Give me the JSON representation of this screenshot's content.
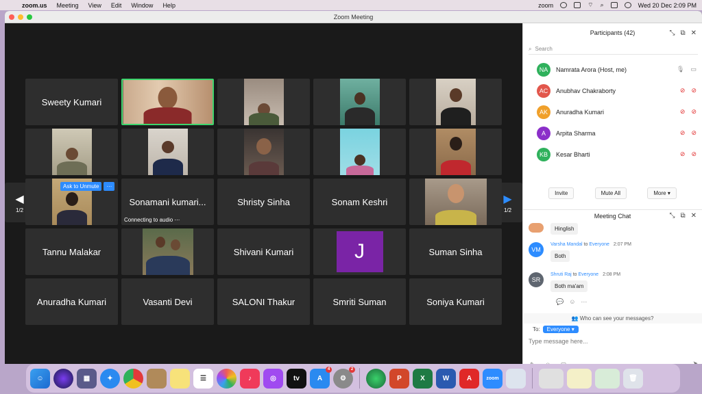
{
  "menubar": {
    "app": "zoom.us",
    "items": [
      "Meeting",
      "View",
      "Edit",
      "Window",
      "Help"
    ],
    "status_brand": "zoom",
    "clock": "Wed 20 Dec  2:09 PM"
  },
  "window": {
    "title": "Zoom Meeting"
  },
  "tiles": {
    "t0": "Sweety Kumari",
    "t12": "Sonamani kumari...",
    "t13": "Shristy Sinha",
    "t14": "Sonam Keshri",
    "t16": "Tannu Malakar",
    "t18": "Shivani Kumari",
    "t19_avatar": "J",
    "t20": "Suman Sinha",
    "t21": "Anuradha Kumari",
    "t22": "Vasanti Devi",
    "t23": "SALONI Thakur",
    "t24": "Smriti Suman",
    "t25": "Soniya Kumari",
    "connecting": "Connecting to audio",
    "ask_unmute": "Ask to Unmute",
    "more": "···"
  },
  "pager": {
    "left": "1/2",
    "right": "1/2"
  },
  "participants": {
    "title": "Participants (42)",
    "search_placeholder": "Search",
    "list": [
      {
        "initials": "NA",
        "name": "Namrata Arora (Host, me)",
        "color": "#2fb15c"
      },
      {
        "initials": "AC",
        "name": "Anubhav Chakraborty",
        "color": "#e2574c"
      },
      {
        "initials": "AK",
        "name": "Anuradha Kumari",
        "color": "#f0a02b"
      },
      {
        "initials": "A",
        "name": "Arpita Sharma",
        "color": "#8b2fc9"
      },
      {
        "initials": "KB",
        "name": "Kesar Bharti",
        "color": "#2fb15c"
      }
    ],
    "buttons": {
      "invite": "Invite",
      "mute_all": "Mute All",
      "more": "More ▾"
    }
  },
  "chat": {
    "title": "Meeting Chat",
    "prev_message": "Hinglish",
    "messages": [
      {
        "initials": "VM",
        "sender": "Varsha Mandal",
        "to": "to",
        "target": "Everyone",
        "time": "2:07 PM",
        "text": "Both",
        "color": "#2d8cff"
      },
      {
        "initials": "SR",
        "sender": "Shruti Raj",
        "to": "to",
        "target": "Everyone",
        "time": "2:08 PM",
        "text": "Both ma'am",
        "color": "#5f6670"
      }
    ],
    "who_can_see": "Who can see your messages?",
    "to_label": "To:",
    "to_value": "Everyone ▾",
    "input_placeholder": "Type message here..."
  },
  "colors": {
    "accent": "#2d8cff",
    "active_border": "#3dd56d",
    "muted": "#e02828",
    "avatar_j": "#7a24a6"
  },
  "dock": {
    "badges": {
      "appstore": "4",
      "settings": "2"
    },
    "zoom_label": "zoom",
    "tv_label": "tv"
  }
}
